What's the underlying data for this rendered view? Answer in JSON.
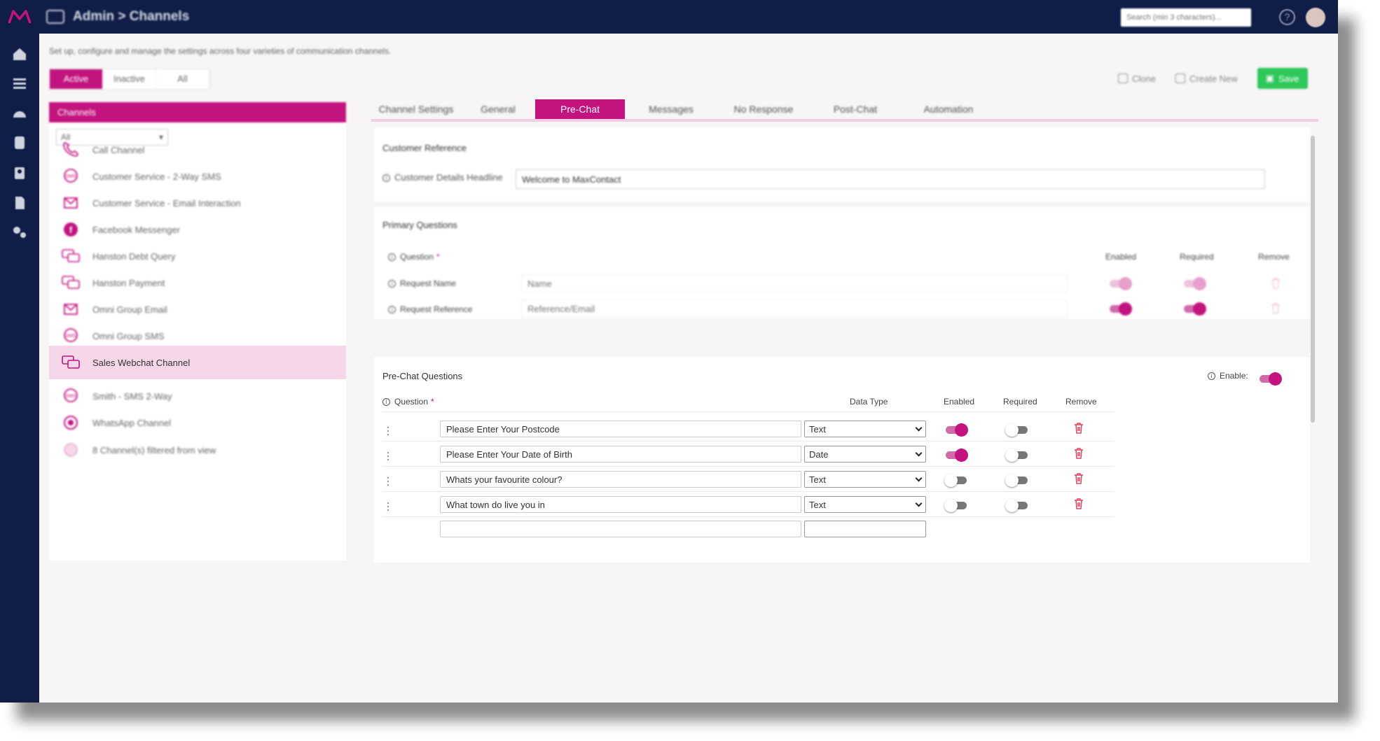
{
  "app": {
    "breadcrumb": "Admin > Channels",
    "search_placeholder": "Search (min 3 characters)..."
  },
  "page": {
    "subtitle": "Set up, configure and manage the settings across four varieties of communication channels.",
    "filter_tabs": [
      "Active",
      "Inactive",
      "All"
    ],
    "actions": {
      "clone": "Clone",
      "create_new": "Create New",
      "save": "Save"
    }
  },
  "channels": {
    "header": "Channels",
    "filter_value": "All",
    "items": [
      {
        "label": "Call Channel",
        "icon": "phone-icon"
      },
      {
        "label": "Customer Service - 2-Way SMS",
        "icon": "sms-icon"
      },
      {
        "label": "Customer Service - Email Interaction",
        "icon": "email-icon"
      },
      {
        "label": "Facebook Messenger",
        "icon": "facebook-icon"
      },
      {
        "label": "Hanston Debt Query",
        "icon": "webchat-icon"
      },
      {
        "label": "Hanston Payment",
        "icon": "webchat-icon"
      },
      {
        "label": "Omni Group Email",
        "icon": "email-icon"
      },
      {
        "label": "Omni Group SMS",
        "icon": "sms-icon"
      },
      {
        "label": "Sales Webchat Channel",
        "icon": "webchat-icon",
        "selected": true
      },
      {
        "label": "Smith - SMS 2-Way",
        "icon": "sms-icon"
      },
      {
        "label": "WhatsApp Channel",
        "icon": "whatsapp-icon"
      },
      {
        "label": "8 Channel(s) filtered from view",
        "icon": "filter-icon"
      }
    ]
  },
  "tabs": [
    "Channel Settings",
    "General",
    "Pre-Chat",
    "Messages",
    "No Response",
    "Post-Chat",
    "Automation"
  ],
  "active_tab": "Pre-Chat",
  "customer_reference": {
    "title": "Customer Reference",
    "label": "Customer Details Headline",
    "value": "Welcome to MaxContact"
  },
  "primary_questions": {
    "title": "Primary Questions",
    "headers": {
      "question": "Question",
      "enabled": "Enabled",
      "required": "Required",
      "remove": "Remove"
    },
    "rows": [
      {
        "label": "Request Name",
        "placeholder": "Name",
        "enabled": true,
        "required": true,
        "locked": true
      },
      {
        "label": "Request Reference",
        "placeholder": "Reference/Email",
        "enabled": true,
        "required": true,
        "locked": false
      }
    ]
  },
  "prechat": {
    "title": "Pre-Chat Questions",
    "enable_label": "Enable:",
    "enabled": true,
    "headers": {
      "question": "Question",
      "data_type": "Data Type",
      "enabled": "Enabled",
      "required": "Required",
      "remove": "Remove"
    },
    "rows": [
      {
        "question": "Please Enter Your Postcode",
        "type": "Text",
        "enabled": true,
        "required": false
      },
      {
        "question": "Please Enter Your Date of Birth",
        "type": "Date",
        "enabled": true,
        "required": false
      },
      {
        "question": "Whats your favourite colour?",
        "type": "Text",
        "enabled": false,
        "required": false
      },
      {
        "question": "What town do live you in",
        "type": "Text",
        "enabled": false,
        "required": false
      }
    ]
  },
  "colors": {
    "accent": "#c2137e",
    "nav": "#0f1d47",
    "save": "#2ec75a",
    "selected_row": "#f6d7e9"
  }
}
